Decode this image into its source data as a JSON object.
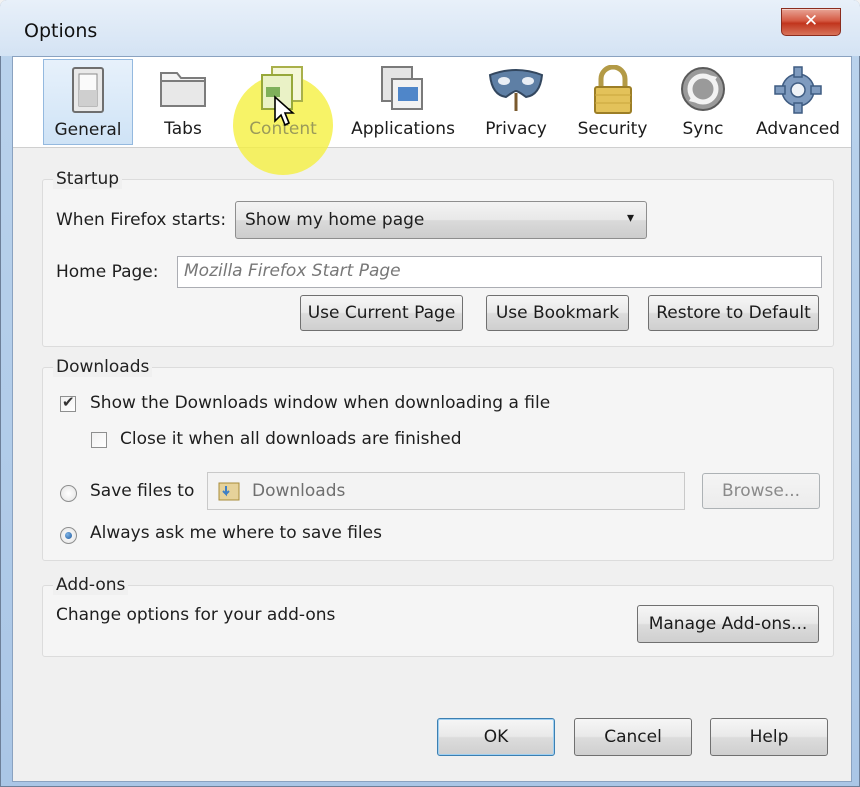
{
  "window": {
    "title": "Options",
    "close_glyph": "✕"
  },
  "toolbar": {
    "tabs": [
      {
        "label": "General",
        "icon": "general-switch-icon",
        "selected": true
      },
      {
        "label": "Tabs",
        "icon": "tabs-folder-icon"
      },
      {
        "label": "Content",
        "icon": "content-icon"
      },
      {
        "label": "Applications",
        "icon": "applications-icon"
      },
      {
        "label": "Privacy",
        "icon": "privacy-mask-icon"
      },
      {
        "label": "Security",
        "icon": "security-lock-icon"
      },
      {
        "label": "Sync",
        "icon": "sync-icon"
      },
      {
        "label": "Advanced",
        "icon": "advanced-gear-icon"
      }
    ]
  },
  "startup": {
    "title": "Startup",
    "when_starts_label": "When Firefox starts:",
    "when_starts_value": "Show my home page",
    "home_page_label": "Home Page:",
    "home_page_value": "Mozilla Firefox Start Page",
    "use_current_page": "Use Current Page",
    "use_bookmark": "Use Bookmark",
    "restore_default": "Restore to Default"
  },
  "downloads": {
    "title": "Downloads",
    "show_window_label": "Show the Downloads window when downloading a file",
    "show_window_checked": true,
    "close_it_label": "Close it when all downloads are finished",
    "close_it_checked": false,
    "save_files_label": "Save files to",
    "save_folder": "Downloads",
    "browse": "Browse...",
    "always_ask_label": "Always ask me where to save files",
    "selected_option": "always_ask"
  },
  "addons": {
    "title": "Add-ons",
    "description": "Change options for your add-ons",
    "manage": "Manage Add-ons..."
  },
  "footer": {
    "ok": "OK",
    "cancel": "Cancel",
    "help": "Help"
  },
  "colors": {
    "selected_tab_bg": "#cfe3f6",
    "close_button": "#c1351d",
    "highlight": "#f5f03c"
  }
}
